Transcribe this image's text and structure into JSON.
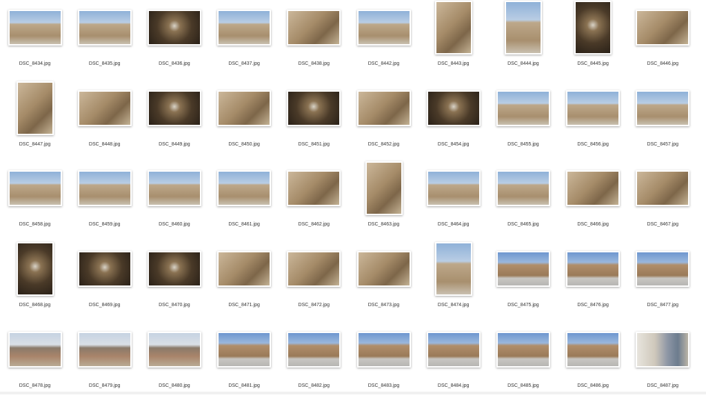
{
  "files": [
    [
      {
        "name": "DSC_8434.jpg",
        "o": "L",
        "tone": "sky"
      },
      {
        "name": "DSC_8435.jpg",
        "o": "L",
        "tone": "sky"
      },
      {
        "name": "DSC_8436.jpg",
        "o": "L",
        "tone": "dark"
      },
      {
        "name": "DSC_8437.jpg",
        "o": "L",
        "tone": "sky"
      },
      {
        "name": "DSC_8438.jpg",
        "o": "L",
        "tone": "stone"
      },
      {
        "name": "DSC_8442.jpg",
        "o": "L",
        "tone": "sky"
      },
      {
        "name": "DSC_8443.jpg",
        "o": "P",
        "tone": "stone"
      },
      {
        "name": "DSC_8444.jpg",
        "o": "P",
        "tone": "sky"
      },
      {
        "name": "DSC_8445.jpg",
        "o": "P",
        "tone": "dark"
      },
      {
        "name": "DSC_8446.jpg",
        "o": "L",
        "tone": "stone"
      }
    ],
    [
      {
        "name": "DSC_8447.jpg",
        "o": "P",
        "tone": "stone"
      },
      {
        "name": "DSC_8448.jpg",
        "o": "L",
        "tone": "stone"
      },
      {
        "name": "DSC_8449.jpg",
        "o": "L",
        "tone": "dark"
      },
      {
        "name": "DSC_8450.jpg",
        "o": "L",
        "tone": "stone"
      },
      {
        "name": "DSC_8451.jpg",
        "o": "L",
        "tone": "dark"
      },
      {
        "name": "DSC_8452.jpg",
        "o": "L",
        "tone": "stone"
      },
      {
        "name": "DSC_8454.jpg",
        "o": "L",
        "tone": "dark"
      },
      {
        "name": "DSC_8455.jpg",
        "o": "L",
        "tone": "sky"
      },
      {
        "name": "DSC_8456.jpg",
        "o": "L",
        "tone": "sky"
      },
      {
        "name": "DSC_8457.jpg",
        "o": "L",
        "tone": "sky"
      }
    ],
    [
      {
        "name": "DSC_8458.jpg",
        "o": "L",
        "tone": "sky"
      },
      {
        "name": "DSC_8459.jpg",
        "o": "L",
        "tone": "sky"
      },
      {
        "name": "DSC_8460.jpg",
        "o": "L",
        "tone": "sky"
      },
      {
        "name": "DSC_8461.jpg",
        "o": "L",
        "tone": "sky"
      },
      {
        "name": "DSC_8462.jpg",
        "o": "L",
        "tone": "stone"
      },
      {
        "name": "DSC_8463.jpg",
        "o": "P",
        "tone": "stone"
      },
      {
        "name": "DSC_8464.jpg",
        "o": "L",
        "tone": "sky"
      },
      {
        "name": "DSC_8465.jpg",
        "o": "L",
        "tone": "sky"
      },
      {
        "name": "DSC_8466.jpg",
        "o": "L",
        "tone": "stone"
      },
      {
        "name": "DSC_8467.jpg",
        "o": "L",
        "tone": "stone"
      }
    ],
    [
      {
        "name": "DSC_8468.jpg",
        "o": "P",
        "tone": "dark"
      },
      {
        "name": "DSC_8469.jpg",
        "o": "L",
        "tone": "dark"
      },
      {
        "name": "DSC_8470.jpg",
        "o": "L",
        "tone": "dark"
      },
      {
        "name": "DSC_8471.jpg",
        "o": "L",
        "tone": "stone"
      },
      {
        "name": "DSC_8472.jpg",
        "o": "L",
        "tone": "stone"
      },
      {
        "name": "DSC_8473.jpg",
        "o": "L",
        "tone": "stone"
      },
      {
        "name": "DSC_8474.jpg",
        "o": "P",
        "tone": "sky"
      },
      {
        "name": "DSC_8475.jpg",
        "o": "L",
        "tone": "arena"
      },
      {
        "name": "DSC_8476.jpg",
        "o": "L",
        "tone": "arena"
      },
      {
        "name": "DSC_8477.jpg",
        "o": "L",
        "tone": "arena"
      }
    ],
    [
      {
        "name": "DSC_8478.jpg",
        "o": "L",
        "tone": "street"
      },
      {
        "name": "DSC_8479.jpg",
        "o": "L",
        "tone": "street"
      },
      {
        "name": "DSC_8480.jpg",
        "o": "L",
        "tone": "street"
      },
      {
        "name": "DSC_8481.jpg",
        "o": "L",
        "tone": "arena"
      },
      {
        "name": "DSC_8482.jpg",
        "o": "L",
        "tone": "arena"
      },
      {
        "name": "DSC_8483.jpg",
        "o": "L",
        "tone": "arena"
      },
      {
        "name": "DSC_8484.jpg",
        "o": "L",
        "tone": "arena"
      },
      {
        "name": "DSC_8485.jpg",
        "o": "L",
        "tone": "arena"
      },
      {
        "name": "DSC_8486.jpg",
        "o": "L",
        "tone": "arena"
      },
      {
        "name": "DSC_8487.jpg",
        "o": "L",
        "tone": "people"
      }
    ]
  ]
}
